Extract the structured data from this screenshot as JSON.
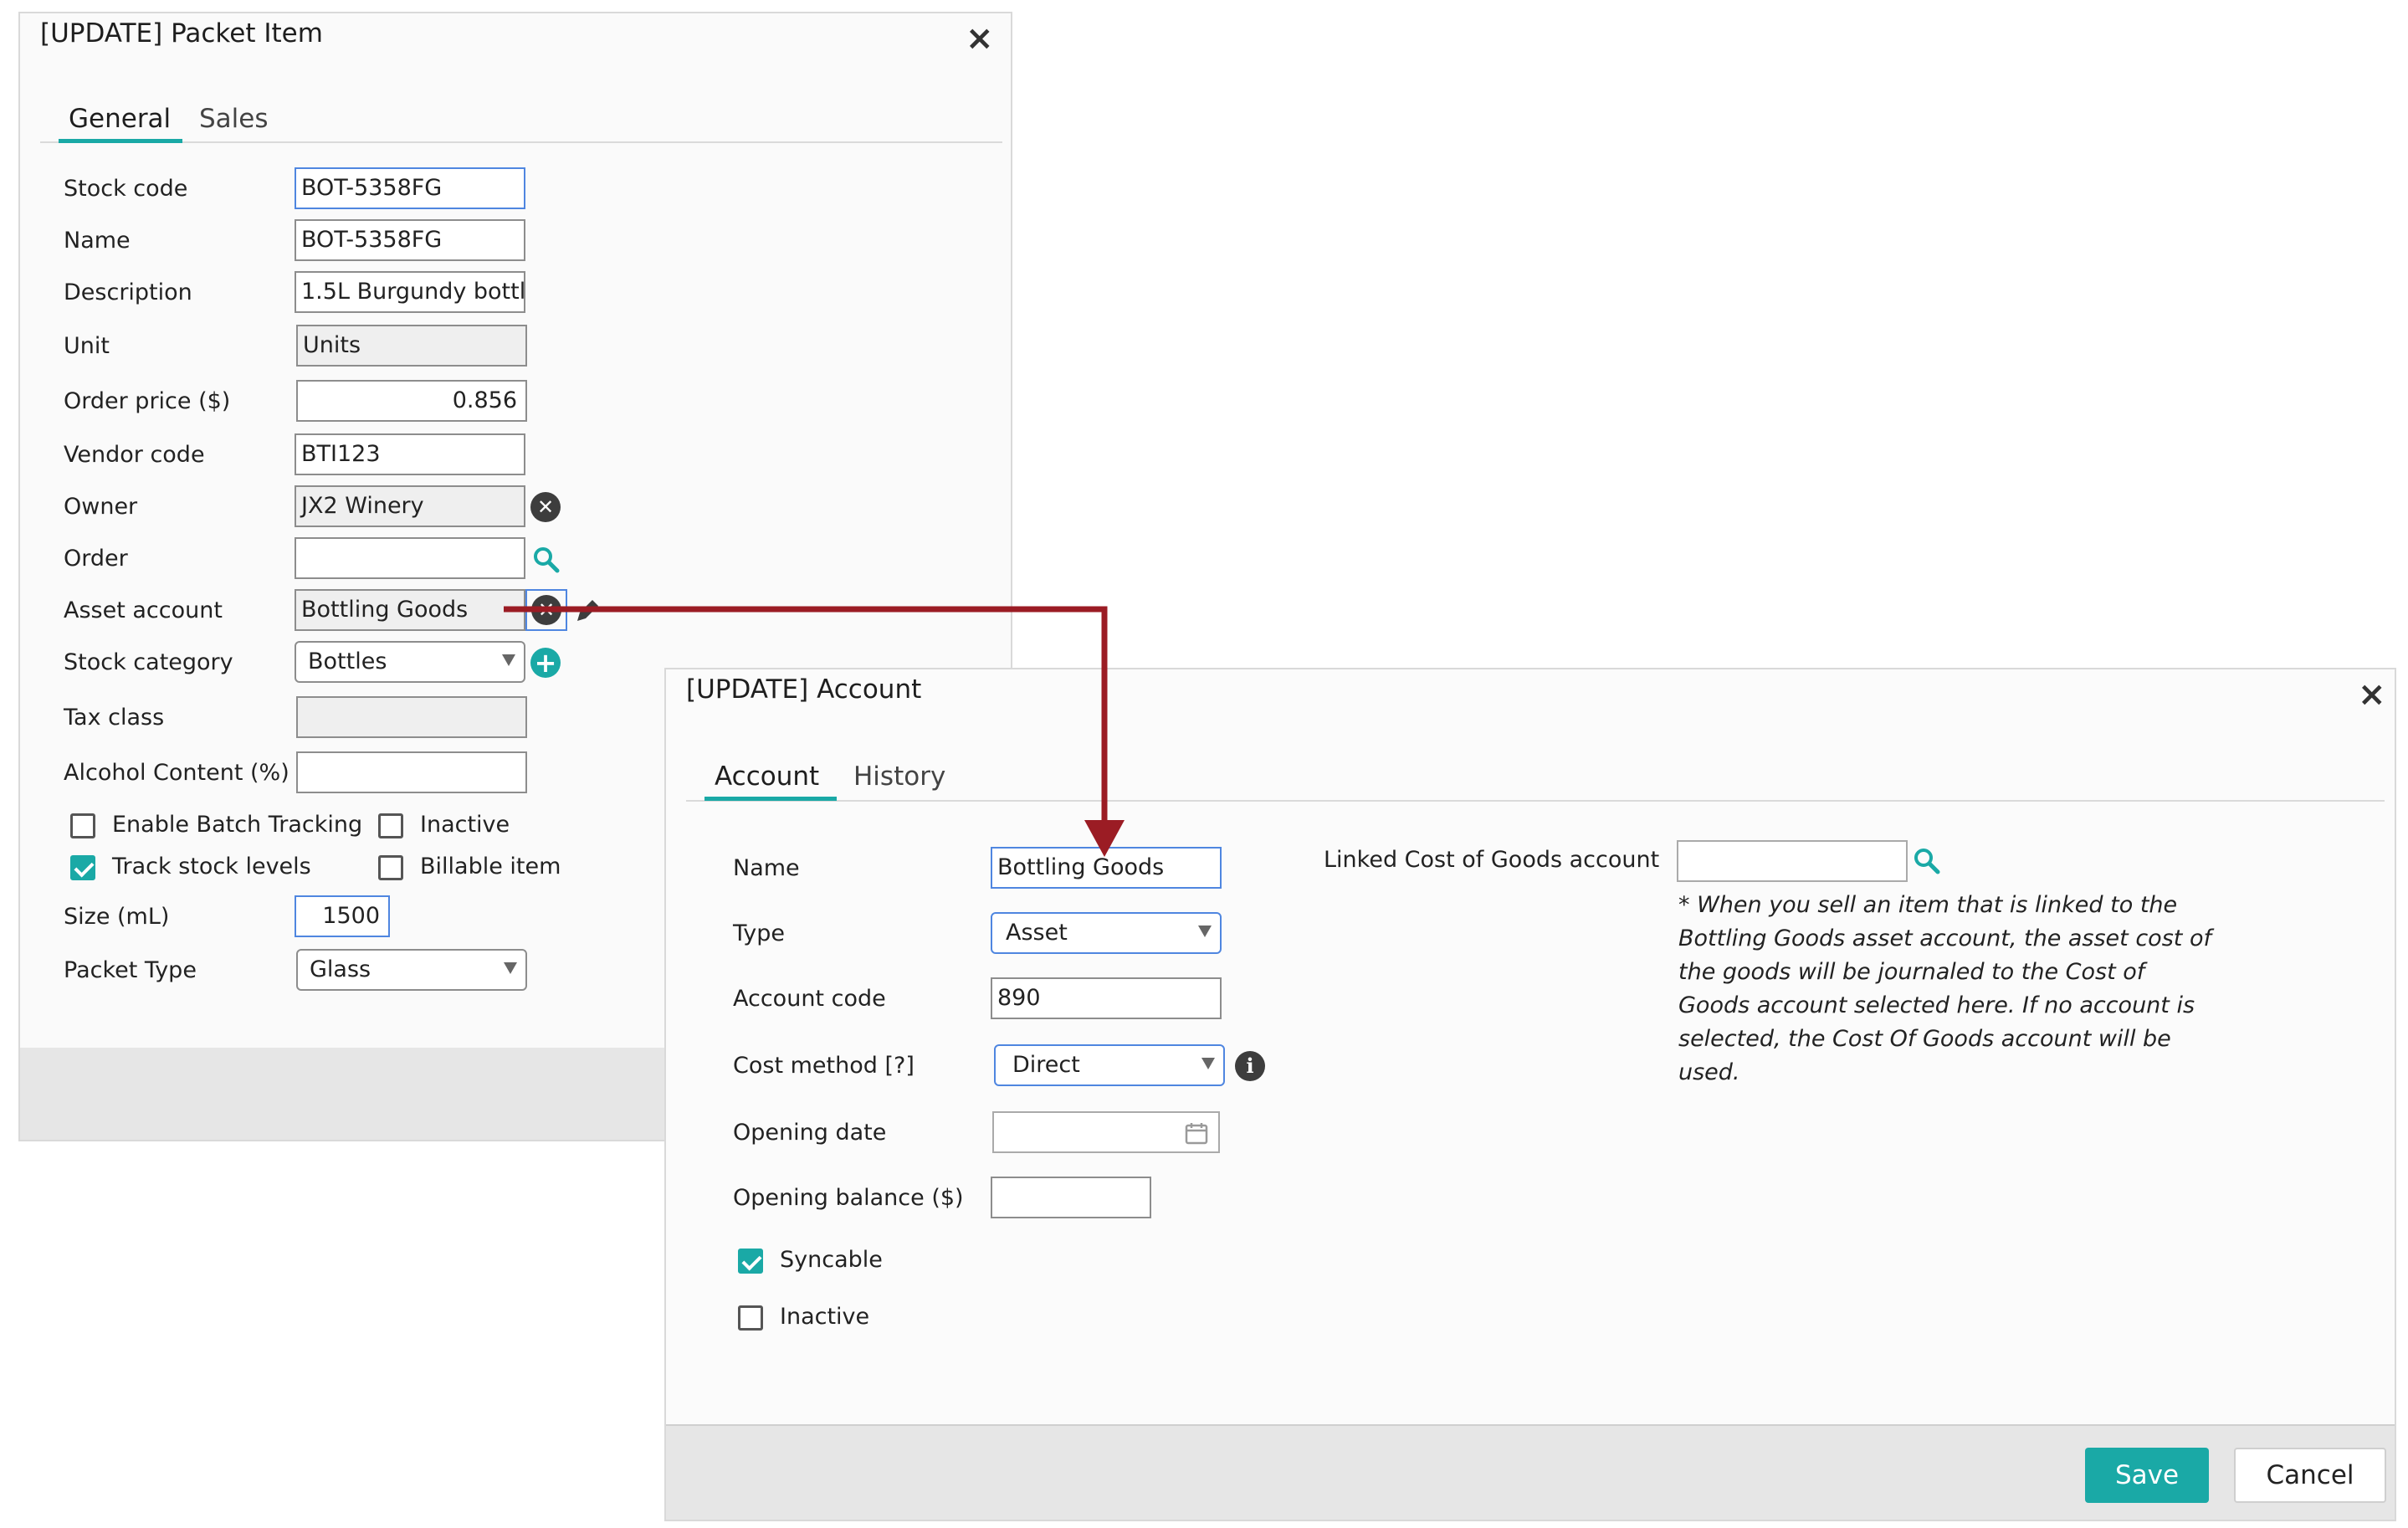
{
  "packet_dialog": {
    "title": "[UPDATE] Packet Item",
    "tabs": [
      "General",
      "Sales"
    ],
    "fields": {
      "stock_code": {
        "label": "Stock code",
        "value": "BOT-5358FG"
      },
      "name": {
        "label": "Name",
        "value": "BOT-5358FG"
      },
      "description": {
        "label": "Description",
        "value": "1.5L Burgundy bottl"
      },
      "unit": {
        "label": "Unit",
        "value": "Units"
      },
      "order_price": {
        "label": "Order price ($)",
        "value": "0.856"
      },
      "vendor_code": {
        "label": "Vendor code",
        "value": "BTI123"
      },
      "owner": {
        "label": "Owner",
        "value": "JX2 Winery"
      },
      "order": {
        "label": "Order",
        "value": ""
      },
      "asset_account": {
        "label": "Asset account",
        "value": "Bottling Goods"
      },
      "stock_category": {
        "label": "Stock category",
        "value": "Bottles"
      },
      "tax_class": {
        "label": "Tax class",
        "value": ""
      },
      "alcohol_content": {
        "label": "Alcohol Content (%)",
        "value": ""
      },
      "size": {
        "label": "Size (mL)",
        "value": "1500"
      },
      "packet_type": {
        "label": "Packet Type",
        "value": "Glass"
      }
    },
    "checkboxes": {
      "enable_batch_tracking": {
        "label": "Enable Batch Tracking",
        "checked": false
      },
      "inactive": {
        "label": "Inactive",
        "checked": false
      },
      "track_stock_levels": {
        "label": "Track stock levels",
        "checked": true
      },
      "billable_item": {
        "label": "Billable item",
        "checked": false
      }
    }
  },
  "account_dialog": {
    "title": "[UPDATE] Account",
    "tabs": [
      "Account",
      "History"
    ],
    "fields": {
      "name": {
        "label": "Name",
        "value": "Bottling Goods"
      },
      "type": {
        "label": "Type",
        "value": "Asset"
      },
      "account_code": {
        "label": "Account code",
        "value": "890"
      },
      "cost_method": {
        "label": "Cost method [?]",
        "value": "Direct"
      },
      "opening_date": {
        "label": "Opening date",
        "value": ""
      },
      "opening_balance": {
        "label": "Opening balance ($)",
        "value": ""
      },
      "linked_cogs": {
        "label": "Linked Cost of Goods account",
        "value": ""
      }
    },
    "checkboxes": {
      "syncable": {
        "label": "Syncable",
        "checked": true
      },
      "inactive": {
        "label": "Inactive",
        "checked": false
      }
    },
    "note_lines": [
      "* When you sell an item that is linked to the",
      "Bottling Goods asset account, the asset cost of",
      "the goods will be journaled to the Cost of",
      "Goods account selected here. If no account is",
      "selected, the Cost Of Goods account will be",
      "used."
    ],
    "buttons": {
      "save": "Save",
      "cancel": "Cancel"
    }
  },
  "colors": {
    "accent": "#1aa9a6",
    "arrow": "#9b1c24",
    "focus_border": "#4f86e0"
  },
  "icons": [
    "close-icon",
    "clear-icon",
    "search-icon",
    "edit-icon",
    "add-icon",
    "info-icon",
    "calendar-icon",
    "chevron-down-icon"
  ]
}
